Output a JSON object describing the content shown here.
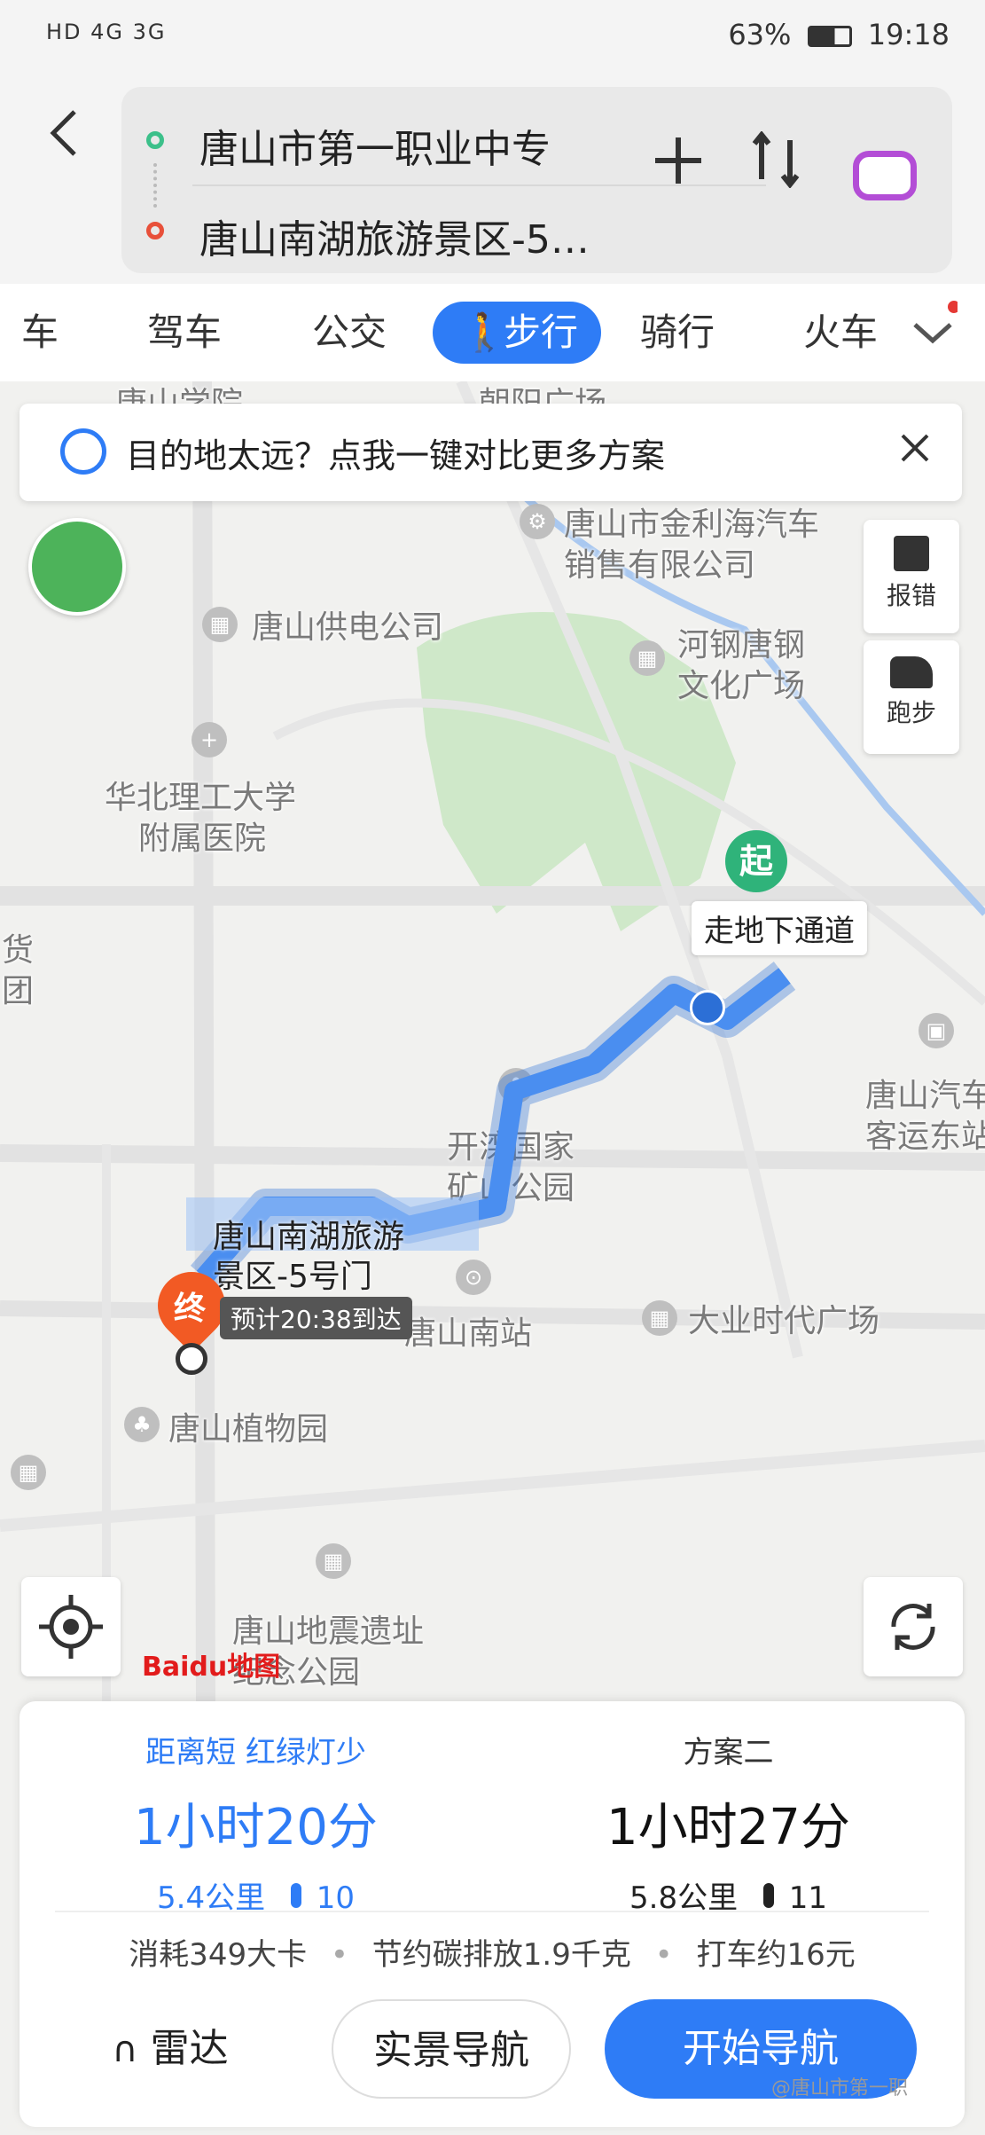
{
  "status": {
    "left": "HD 4G 3G",
    "battery": "63%",
    "time": "19:18"
  },
  "header": {
    "origin": "唐山市第一职业中专",
    "destination": "唐山南湖旅游景区-5…",
    "add_icon": "plus-icon",
    "swap_icon": "swap-icon"
  },
  "tabs": [
    {
      "label": "车"
    },
    {
      "label": "驾车"
    },
    {
      "label": "公交"
    },
    {
      "label": "步行",
      "active": true
    },
    {
      "label": "骑行"
    },
    {
      "label": "火车"
    }
  ],
  "banner": {
    "text": "目的地太远？点我一键对比更多方案"
  },
  "side": {
    "report": "报错",
    "run": "跑步"
  },
  "map_labels": {
    "l1": "唐山市金利海汽车",
    "l1b": "销售有限公司",
    "l2": "唐山供电公司",
    "l3": "河钢唐钢",
    "l3b": "文化广场",
    "l4": "华北理工大学",
    "l4b": "附属医院",
    "l5": "开滦国家",
    "l5b": "矿山公园",
    "l6": "唐山汽车",
    "l6b": "客运东站",
    "l7": "唐山南站",
    "l8": "大业时代广场",
    "l9": "唐山植物园",
    "l10": "唐山地震遗址",
    "l10b": "纪念公园",
    "l11": "货",
    "l11b": "团",
    "l12": "朝阳广场",
    "l13": "唐山学院"
  },
  "route": {
    "start_marker": "起",
    "start_tip": "走地下通道",
    "end_marker": "终",
    "end_name": "唐山南湖旅游",
    "end_name_b": "景区-5号门",
    "eta": "预计20:38到达"
  },
  "logo": "Baidu地图",
  "plans": [
    {
      "tag": "距离短 红绿灯少",
      "time": "1小时20分",
      "dist": "5.4公里",
      "lights": "10",
      "selected": true
    },
    {
      "tag": "方案二",
      "time": "1小时27分",
      "dist": "5.8公里",
      "lights": "11",
      "selected": false
    }
  ],
  "info": {
    "cal": "消耗349大卡",
    "carbon": "节约碳排放1.9千克",
    "taxi": "打车约16元"
  },
  "actions": {
    "radar": "雷达",
    "ar": "实景导航",
    "start": "开始导航"
  },
  "watermark": "@唐山市第一职"
}
